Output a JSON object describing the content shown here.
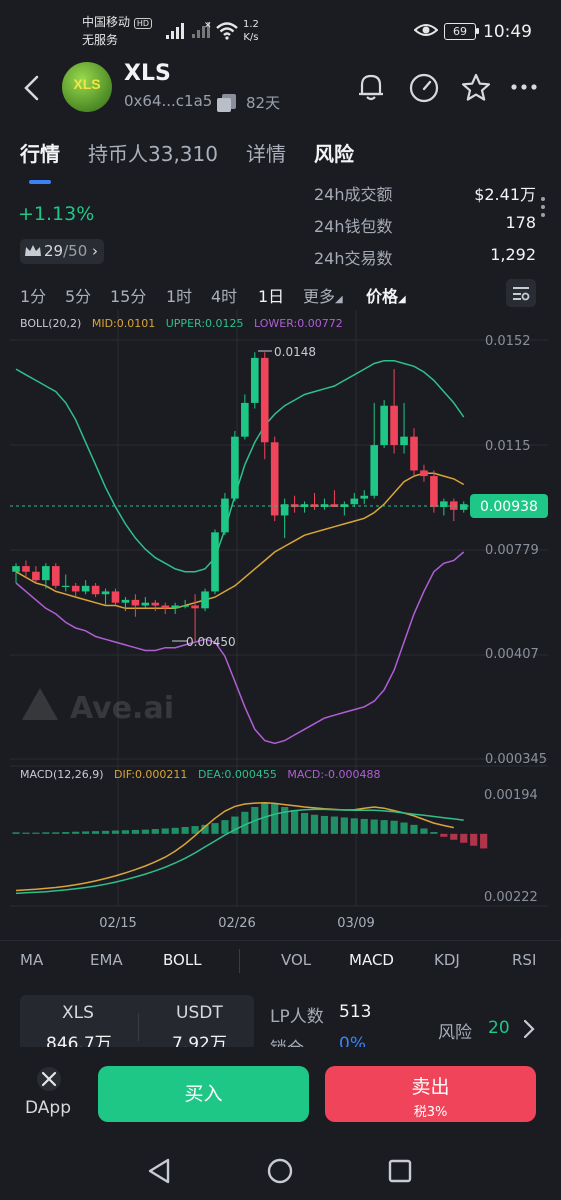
{
  "status_bar": {
    "carrier": "中国移动",
    "hd": "HD",
    "service": "无服务",
    "net_speed_value": "1.2",
    "net_speed_unit": "K/s",
    "battery": "69",
    "time": "10:49"
  },
  "token": {
    "logo_text": "XLS",
    "name": "XLS",
    "address": "0x64...c1a5",
    "age": "82天"
  },
  "tabs": [
    "行情",
    "持币人33,310",
    "详情",
    "风险"
  ],
  "price_change": "+1.13%",
  "rank": {
    "value": "29",
    "total": "/50"
  },
  "stats": [
    {
      "label": "24h成交额",
      "value": "$2.41万"
    },
    {
      "label": "24h钱包数",
      "value": "178"
    },
    {
      "label": "24h交易数",
      "value": "1,292"
    }
  ],
  "timeframes": [
    "1分",
    "5分",
    "15分",
    "1时",
    "4时",
    "1日",
    "更多",
    "价格"
  ],
  "boll": {
    "label": "BOLL(20,2)",
    "mid": "MID:0.0101",
    "upper": "UPPER:0.0125",
    "lower": "LOWER:0.00772"
  },
  "price_axis": [
    "0.0152",
    "0.0115",
    "0.00779",
    "0.00407",
    "0.000345"
  ],
  "current_price": "0.00938",
  "annotations": {
    "high": "0.0148",
    "low": "0.00450"
  },
  "watermark": "Ave.ai",
  "macd": {
    "label": "MACD(12,26,9)",
    "dif": "DIF:0.000211",
    "dea": "DEA:0.000455",
    "macd": "MACD:-0.000488",
    "axis_top": "0.00194",
    "axis_bottom": "0.00222"
  },
  "date_axis": [
    "02/15",
    "02/26",
    "03/09"
  ],
  "indicator_tabs": [
    "MA",
    "EMA",
    "BOLL",
    "VOL",
    "MACD",
    "KDJ",
    "RSI"
  ],
  "pool": {
    "token_symbol": "XLS",
    "token_amount": "846.7万",
    "quote_symbol": "USDT",
    "quote_amount": "7.92万"
  },
  "lp": {
    "label": "LP人数",
    "value": "513",
    "lock_label": "锁仓",
    "lock_value": "0%"
  },
  "risk": {
    "label": "风险",
    "value": "20"
  },
  "actions": {
    "dapp": "DApp",
    "buy": "买入",
    "sell": "卖出",
    "sell_tax": "税3%"
  },
  "colors": {
    "up": "#1ec785",
    "down": "#f0445a",
    "mid": "#d9a53a",
    "upper": "#2fbf8a",
    "lower": "#b05ed6",
    "accent": "#3b82f6"
  },
  "chart_data": {
    "type": "candlestick",
    "candles": [
      {
        "o": 0.007,
        "h": 0.0073,
        "l": 0.0066,
        "c": 0.0072
      },
      {
        "o": 0.0072,
        "h": 0.0074,
        "l": 0.0068,
        "c": 0.007
      },
      {
        "o": 0.007,
        "h": 0.0072,
        "l": 0.0066,
        "c": 0.0067
      },
      {
        "o": 0.0067,
        "h": 0.0073,
        "l": 0.0064,
        "c": 0.0072
      },
      {
        "o": 0.0072,
        "h": 0.0073,
        "l": 0.0064,
        "c": 0.0065
      },
      {
        "o": 0.0065,
        "h": 0.0069,
        "l": 0.0063,
        "c": 0.0065
      },
      {
        "o": 0.0065,
        "h": 0.0066,
        "l": 0.0061,
        "c": 0.0063
      },
      {
        "o": 0.0063,
        "h": 0.0067,
        "l": 0.0062,
        "c": 0.0065
      },
      {
        "o": 0.0065,
        "h": 0.0066,
        "l": 0.0061,
        "c": 0.0062
      },
      {
        "o": 0.0062,
        "h": 0.0064,
        "l": 0.0058,
        "c": 0.0063
      },
      {
        "o": 0.0063,
        "h": 0.0064,
        "l": 0.0058,
        "c": 0.0059
      },
      {
        "o": 0.0059,
        "h": 0.0061,
        "l": 0.0056,
        "c": 0.006
      },
      {
        "o": 0.006,
        "h": 0.0062,
        "l": 0.0054,
        "c": 0.0058
      },
      {
        "o": 0.0058,
        "h": 0.0061,
        "l": 0.0057,
        "c": 0.0059
      },
      {
        "o": 0.0059,
        "h": 0.006,
        "l": 0.0056,
        "c": 0.0058
      },
      {
        "o": 0.0058,
        "h": 0.0059,
        "l": 0.0055,
        "c": 0.0057
      },
      {
        "o": 0.0057,
        "h": 0.0059,
        "l": 0.0055,
        "c": 0.0058
      },
      {
        "o": 0.0058,
        "h": 0.006,
        "l": 0.0057,
        "c": 0.0058
      },
      {
        "o": 0.0058,
        "h": 0.0062,
        "l": 0.0045,
        "c": 0.0057
      },
      {
        "o": 0.0057,
        "h": 0.0064,
        "l": 0.0056,
        "c": 0.0063
      },
      {
        "o": 0.0063,
        "h": 0.0085,
        "l": 0.0062,
        "c": 0.0084
      },
      {
        "o": 0.0084,
        "h": 0.0098,
        "l": 0.0083,
        "c": 0.0096
      },
      {
        "o": 0.0096,
        "h": 0.012,
        "l": 0.0095,
        "c": 0.0118
      },
      {
        "o": 0.0118,
        "h": 0.0133,
        "l": 0.0117,
        "c": 0.013
      },
      {
        "o": 0.013,
        "h": 0.0148,
        "l": 0.0128,
        "c": 0.0146
      },
      {
        "o": 0.0146,
        "h": 0.0148,
        "l": 0.011,
        "c": 0.0116
      },
      {
        "o": 0.0116,
        "h": 0.0118,
        "l": 0.0088,
        "c": 0.009
      },
      {
        "o": 0.009,
        "h": 0.0096,
        "l": 0.0082,
        "c": 0.0094
      },
      {
        "o": 0.0094,
        "h": 0.0097,
        "l": 0.0091,
        "c": 0.0093
      },
      {
        "o": 0.0093,
        "h": 0.0095,
        "l": 0.0091,
        "c": 0.0094
      },
      {
        "o": 0.0094,
        "h": 0.0098,
        "l": 0.0092,
        "c": 0.0093
      },
      {
        "o": 0.0093,
        "h": 0.0096,
        "l": 0.0092,
        "c": 0.0094
      },
      {
        "o": 0.0094,
        "h": 0.0099,
        "l": 0.0093,
        "c": 0.0093
      },
      {
        "o": 0.0093,
        "h": 0.0095,
        "l": 0.009,
        "c": 0.0094
      },
      {
        "o": 0.0094,
        "h": 0.0098,
        "l": 0.0093,
        "c": 0.0096
      },
      {
        "o": 0.0096,
        "h": 0.0099,
        "l": 0.0094,
        "c": 0.0097
      },
      {
        "o": 0.0097,
        "h": 0.013,
        "l": 0.0096,
        "c": 0.0115
      },
      {
        "o": 0.0115,
        "h": 0.0131,
        "l": 0.0114,
        "c": 0.0129
      },
      {
        "o": 0.0129,
        "h": 0.0142,
        "l": 0.0112,
        "c": 0.0115
      },
      {
        "o": 0.0115,
        "h": 0.013,
        "l": 0.0112,
        "c": 0.0118
      },
      {
        "o": 0.0118,
        "h": 0.0121,
        "l": 0.0104,
        "c": 0.0106
      },
      {
        "o": 0.0106,
        "h": 0.0108,
        "l": 0.0102,
        "c": 0.0104
      },
      {
        "o": 0.0104,
        "h": 0.0106,
        "l": 0.0091,
        "c": 0.0093
      },
      {
        "o": 0.0093,
        "h": 0.0096,
        "l": 0.009,
        "c": 0.0095
      },
      {
        "o": 0.0095,
        "h": 0.0096,
        "l": 0.0088,
        "c": 0.0092
      },
      {
        "o": 0.0092,
        "h": 0.0095,
        "l": 0.0091,
        "c": 0.0094
      }
    ],
    "boll_upper": [
      0.0142,
      0.014,
      0.0138,
      0.0136,
      0.0134,
      0.013,
      0.0124,
      0.0116,
      0.0108,
      0.01,
      0.0093,
      0.0087,
      0.0082,
      0.0078,
      0.0075,
      0.0073,
      0.0071,
      0.007,
      0.007,
      0.0071,
      0.0075,
      0.0085,
      0.0097,
      0.0108,
      0.0116,
      0.0122,
      0.0126,
      0.0129,
      0.0131,
      0.0133,
      0.0134,
      0.0135,
      0.0136,
      0.0138,
      0.014,
      0.0142,
      0.0144,
      0.0145,
      0.0145,
      0.0144,
      0.0143,
      0.0141,
      0.0138,
      0.0134,
      0.013,
      0.0125
    ],
    "boll_mid": [
      0.007,
      0.0068,
      0.0066,
      0.0065,
      0.0063,
      0.0062,
      0.0061,
      0.006,
      0.0059,
      0.0058,
      0.0058,
      0.0057,
      0.0057,
      0.0057,
      0.0057,
      0.0057,
      0.0057,
      0.0058,
      0.0059,
      0.006,
      0.0061,
      0.0063,
      0.0065,
      0.0068,
      0.0071,
      0.0074,
      0.0077,
      0.0079,
      0.0081,
      0.0083,
      0.0084,
      0.0085,
      0.0086,
      0.0087,
      0.0088,
      0.0089,
      0.0091,
      0.0094,
      0.0098,
      0.0102,
      0.0104,
      0.0105,
      0.0105,
      0.0104,
      0.0103,
      0.0101
    ],
    "boll_lower": [
      0.0066,
      0.0063,
      0.006,
      0.0057,
      0.0055,
      0.0052,
      0.005,
      0.0049,
      0.0047,
      0.0046,
      0.0045,
      0.0044,
      0.0043,
      0.0042,
      0.0042,
      0.0043,
      0.0043,
      0.0044,
      0.0045,
      0.0046,
      0.0045,
      0.004,
      0.0031,
      0.0022,
      0.0014,
      0.001,
      0.0009,
      0.001,
      0.0012,
      0.0014,
      0.0016,
      0.0018,
      0.0019,
      0.002,
      0.0021,
      0.0022,
      0.0024,
      0.0028,
      0.0035,
      0.0045,
      0.0055,
      0.0063,
      0.007,
      0.0073,
      0.0074,
      0.0077
    ],
    "macd_hist": [
      5e-05,
      4e-05,
      4e-05,
      5e-05,
      5e-05,
      6e-05,
      7e-05,
      8e-05,
      9e-05,
      0.0001,
      0.00011,
      0.00012,
      0.00013,
      0.00014,
      0.00016,
      0.00018,
      0.0002,
      0.00023,
      0.00026,
      0.0003,
      0.00036,
      0.00046,
      0.00058,
      0.00074,
      0.0009,
      0.00104,
      0.001,
      0.0009,
      0.0008,
      0.0007,
      0.00064,
      0.0006,
      0.00058,
      0.00055,
      0.00052,
      0.0005,
      0.00048,
      0.00046,
      0.00044,
      0.00038,
      0.0003,
      0.00018,
      6e-05,
      -0.0001,
      -0.0002,
      -0.0003,
      -0.0004,
      -0.00049
    ],
    "dif": [
      -0.0019,
      -0.00188,
      -0.00186,
      -0.00183,
      -0.0018,
      -0.00176,
      -0.00171,
      -0.00165,
      -0.00158,
      -0.0015,
      -0.00141,
      -0.00131,
      -0.0012,
      -0.00108,
      -0.00094,
      -0.00078,
      -0.00058,
      -0.00034,
      -6e-05,
      0.00024,
      0.00052,
      0.00076,
      0.00092,
      0.001,
      0.00103,
      0.00104,
      0.00102,
      0.00098,
      0.00094,
      0.0009,
      0.00087,
      0.00084,
      0.00082,
      0.0008,
      0.00081,
      0.00086,
      0.0009,
      0.00086,
      0.00078,
      0.0007,
      0.0006,
      0.00048,
      0.00036,
      0.00028,
      0.00021
    ],
    "dea": [
      -0.002,
      -0.00198,
      -0.00196,
      -0.00194,
      -0.00191,
      -0.00188,
      -0.00184,
      -0.0018,
      -0.00175,
      -0.00169,
      -0.00162,
      -0.00154,
      -0.00145,
      -0.00135,
      -0.00124,
      -0.00112,
      -0.00098,
      -0.00082,
      -0.00064,
      -0.00044,
      -0.00024,
      -4e-05,
      0.00014,
      0.0003,
      0.00044,
      0.00056,
      0.00066,
      0.00073,
      0.00078,
      0.00081,
      0.00082,
      0.00082,
      0.00081,
      0.0008,
      0.00079,
      0.00079,
      0.00079,
      0.00077,
      0.00074,
      0.0007,
      0.00066,
      0.00062,
      0.00058,
      0.00054,
      0.0005,
      0.00046
    ],
    "y_range": [
      0.000345,
      0.0152
    ],
    "macd_range": [
      -0.00222,
      0.00194
    ],
    "grid": true
  }
}
